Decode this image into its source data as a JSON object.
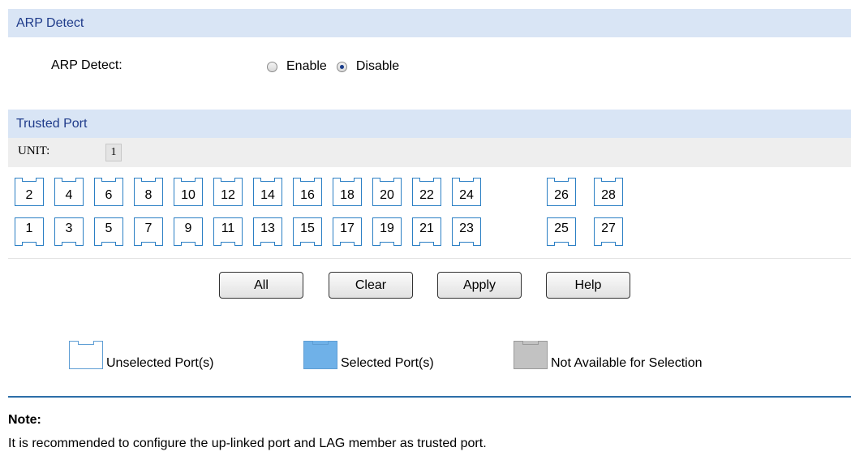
{
  "arp_section": {
    "header": "ARP Detect",
    "label": "ARP Detect:",
    "options": [
      {
        "label": "Enable",
        "checked": false
      },
      {
        "label": "Disable",
        "checked": true
      }
    ]
  },
  "trusted_section": {
    "header": "Trusted Port",
    "unit_label": "UNIT:",
    "unit_value": "1",
    "ports_top": [
      "2",
      "4",
      "6",
      "8",
      "10",
      "12",
      "14",
      "16",
      "18",
      "20",
      "22",
      "24",
      "26",
      "28"
    ],
    "ports_bottom": [
      "1",
      "3",
      "5",
      "7",
      "9",
      "11",
      "13",
      "15",
      "17",
      "19",
      "21",
      "23",
      "25",
      "27"
    ]
  },
  "buttons": {
    "all": "All",
    "clear": "Clear",
    "apply": "Apply",
    "help": "Help"
  },
  "legend": {
    "unselected": "Unselected Port(s)",
    "selected": "Selected Port(s)",
    "unavailable": "Not Available for Selection",
    "colors": {
      "unselected": "#ffffff",
      "selected": "#6fb1e8",
      "unavailable": "#c2c2c2",
      "border": "#2b7fc4"
    }
  },
  "note": {
    "title": "Note:",
    "text": "It is recommended to configure the up-linked port and LAG member as trusted port."
  }
}
